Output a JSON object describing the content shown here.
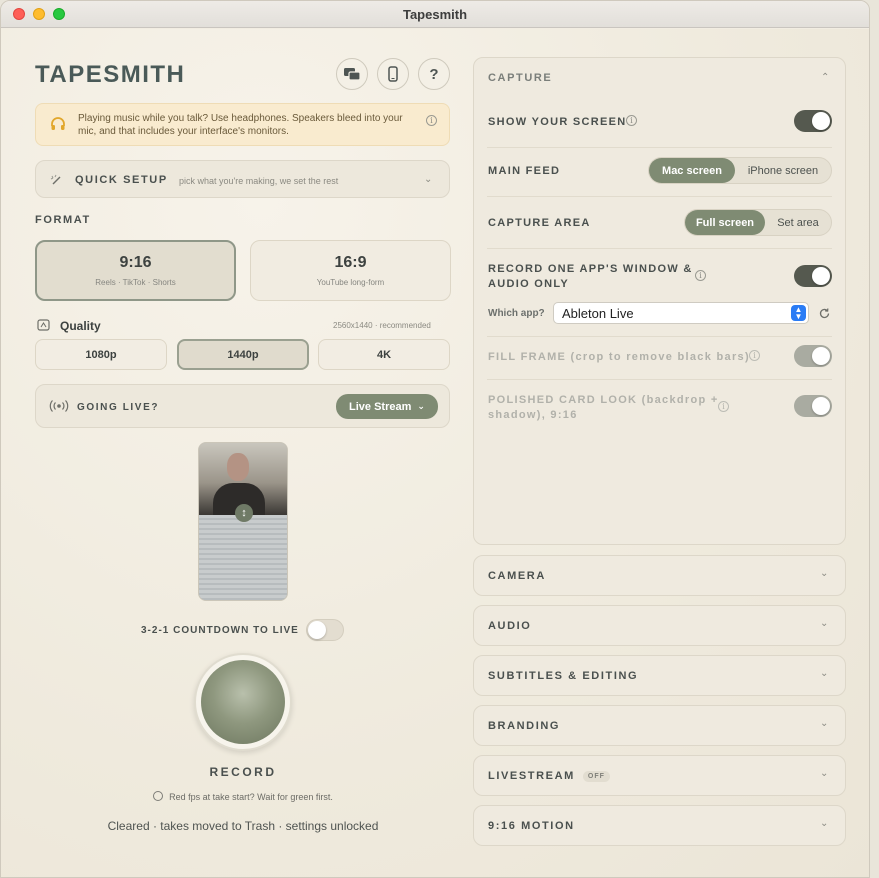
{
  "window": {
    "title": "Tapesmith"
  },
  "brand": "TAPESMITH",
  "header_icons": [
    "windows-icon",
    "phone-icon",
    "help-icon"
  ],
  "help_label": "?",
  "warning": {
    "text": "Playing music while you talk? Use headphones. Speakers bleed into your mic, and that includes your interface's monitors."
  },
  "quick_setup": {
    "label": "QUICK SETUP",
    "hint": "pick what you're making, we set the rest"
  },
  "format": {
    "label": "FORMAT",
    "options": [
      {
        "title": "9:16",
        "sub": "Reels · TikTok · Shorts",
        "selected": true
      },
      {
        "title": "16:9",
        "sub": "YouTube long-form",
        "selected": false
      }
    ]
  },
  "quality": {
    "label": "Quality",
    "recommend": "2560x1440 · recommended",
    "options": [
      "1080p",
      "1440p",
      "4K"
    ],
    "selected": "1440p"
  },
  "going_live": {
    "label": "GOING LIVE?",
    "button": "Live Stream"
  },
  "countdown": {
    "label": "3-2-1 COUNTDOWN TO LIVE",
    "on": false
  },
  "record": {
    "label": "RECORD",
    "hint": "Red fps at take start? Wait for green first.",
    "status": "Cleared · takes moved to Trash · settings unlocked"
  },
  "capture": {
    "title": "CAPTURE",
    "show_screen": {
      "label": "SHOW YOUR SCREEN",
      "on": true
    },
    "main_feed": {
      "label": "MAIN FEED",
      "options": [
        "Mac screen",
        "iPhone screen"
      ],
      "selected": "Mac screen"
    },
    "capture_area": {
      "label": "CAPTURE AREA",
      "options": [
        "Full screen",
        "Set area"
      ],
      "selected": "Full screen"
    },
    "record_one_app": {
      "label_line1": "RECORD ONE APP'S WINDOW &",
      "label_line2": "AUDIO ONLY",
      "on": true
    },
    "which_app": {
      "label": "Which app?",
      "value": "Ableton Live"
    },
    "fill_frame": {
      "label": "FILL FRAME (crop to remove black bars)",
      "on": true
    },
    "polished": {
      "label_line1": "POLISHED CARD LOOK (backdrop +",
      "label_line2": "shadow), 9:16",
      "on": true
    }
  },
  "sections": [
    {
      "label": "CAMERA"
    },
    {
      "label": "AUDIO"
    },
    {
      "label": "SUBTITLES & EDITING"
    },
    {
      "label": "BRANDING"
    },
    {
      "label": "LIVESTREAM",
      "badge": "OFF"
    },
    {
      "label": "9:16 MOTION"
    }
  ],
  "colors": {
    "accent": "#7f8b73",
    "toggle_on": "#55594f",
    "warning_bg": "#f9ebcf",
    "brand": "#4a5a58"
  }
}
